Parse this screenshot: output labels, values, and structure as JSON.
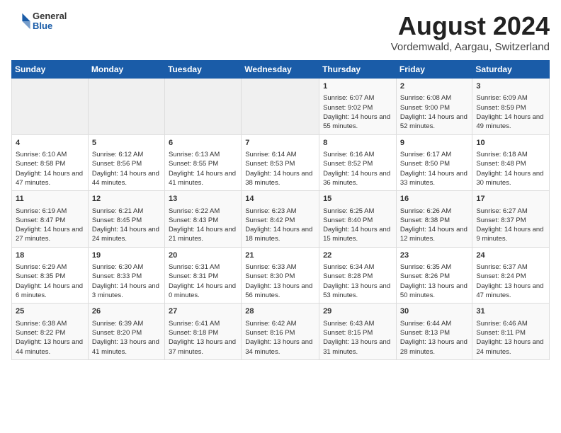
{
  "header": {
    "logo": {
      "general": "General",
      "blue": "Blue"
    },
    "title": "August 2024",
    "location": "Vordemwald, Aargau, Switzerland"
  },
  "weekdays": [
    "Sunday",
    "Monday",
    "Tuesday",
    "Wednesday",
    "Thursday",
    "Friday",
    "Saturday"
  ],
  "weeks": [
    [
      {
        "day": "",
        "empty": true
      },
      {
        "day": "",
        "empty": true
      },
      {
        "day": "",
        "empty": true
      },
      {
        "day": "",
        "empty": true
      },
      {
        "day": "1",
        "sunrise": "6:07 AM",
        "sunset": "9:02 PM",
        "daylight": "14 hours and 55 minutes."
      },
      {
        "day": "2",
        "sunrise": "6:08 AM",
        "sunset": "9:00 PM",
        "daylight": "14 hours and 52 minutes."
      },
      {
        "day": "3",
        "sunrise": "6:09 AM",
        "sunset": "8:59 PM",
        "daylight": "14 hours and 49 minutes."
      }
    ],
    [
      {
        "day": "4",
        "sunrise": "6:10 AM",
        "sunset": "8:58 PM",
        "daylight": "14 hours and 47 minutes."
      },
      {
        "day": "5",
        "sunrise": "6:12 AM",
        "sunset": "8:56 PM",
        "daylight": "14 hours and 44 minutes."
      },
      {
        "day": "6",
        "sunrise": "6:13 AM",
        "sunset": "8:55 PM",
        "daylight": "14 hours and 41 minutes."
      },
      {
        "day": "7",
        "sunrise": "6:14 AM",
        "sunset": "8:53 PM",
        "daylight": "14 hours and 38 minutes."
      },
      {
        "day": "8",
        "sunrise": "6:16 AM",
        "sunset": "8:52 PM",
        "daylight": "14 hours and 36 minutes."
      },
      {
        "day": "9",
        "sunrise": "6:17 AM",
        "sunset": "8:50 PM",
        "daylight": "14 hours and 33 minutes."
      },
      {
        "day": "10",
        "sunrise": "6:18 AM",
        "sunset": "8:48 PM",
        "daylight": "14 hours and 30 minutes."
      }
    ],
    [
      {
        "day": "11",
        "sunrise": "6:19 AM",
        "sunset": "8:47 PM",
        "daylight": "14 hours and 27 minutes."
      },
      {
        "day": "12",
        "sunrise": "6:21 AM",
        "sunset": "8:45 PM",
        "daylight": "14 hours and 24 minutes."
      },
      {
        "day": "13",
        "sunrise": "6:22 AM",
        "sunset": "8:43 PM",
        "daylight": "14 hours and 21 minutes."
      },
      {
        "day": "14",
        "sunrise": "6:23 AM",
        "sunset": "8:42 PM",
        "daylight": "14 hours and 18 minutes."
      },
      {
        "day": "15",
        "sunrise": "6:25 AM",
        "sunset": "8:40 PM",
        "daylight": "14 hours and 15 minutes."
      },
      {
        "day": "16",
        "sunrise": "6:26 AM",
        "sunset": "8:38 PM",
        "daylight": "14 hours and 12 minutes."
      },
      {
        "day": "17",
        "sunrise": "6:27 AM",
        "sunset": "8:37 PM",
        "daylight": "14 hours and 9 minutes."
      }
    ],
    [
      {
        "day": "18",
        "sunrise": "6:29 AM",
        "sunset": "8:35 PM",
        "daylight": "14 hours and 6 minutes."
      },
      {
        "day": "19",
        "sunrise": "6:30 AM",
        "sunset": "8:33 PM",
        "daylight": "14 hours and 3 minutes."
      },
      {
        "day": "20",
        "sunrise": "6:31 AM",
        "sunset": "8:31 PM",
        "daylight": "14 hours and 0 minutes."
      },
      {
        "day": "21",
        "sunrise": "6:33 AM",
        "sunset": "8:30 PM",
        "daylight": "13 hours and 56 minutes."
      },
      {
        "day": "22",
        "sunrise": "6:34 AM",
        "sunset": "8:28 PM",
        "daylight": "13 hours and 53 minutes."
      },
      {
        "day": "23",
        "sunrise": "6:35 AM",
        "sunset": "8:26 PM",
        "daylight": "13 hours and 50 minutes."
      },
      {
        "day": "24",
        "sunrise": "6:37 AM",
        "sunset": "8:24 PM",
        "daylight": "13 hours and 47 minutes."
      }
    ],
    [
      {
        "day": "25",
        "sunrise": "6:38 AM",
        "sunset": "8:22 PM",
        "daylight": "13 hours and 44 minutes."
      },
      {
        "day": "26",
        "sunrise": "6:39 AM",
        "sunset": "8:20 PM",
        "daylight": "13 hours and 41 minutes."
      },
      {
        "day": "27",
        "sunrise": "6:41 AM",
        "sunset": "8:18 PM",
        "daylight": "13 hours and 37 minutes."
      },
      {
        "day": "28",
        "sunrise": "6:42 AM",
        "sunset": "8:16 PM",
        "daylight": "13 hours and 34 minutes."
      },
      {
        "day": "29",
        "sunrise": "6:43 AM",
        "sunset": "8:15 PM",
        "daylight": "13 hours and 31 minutes."
      },
      {
        "day": "30",
        "sunrise": "6:44 AM",
        "sunset": "8:13 PM",
        "daylight": "13 hours and 28 minutes."
      },
      {
        "day": "31",
        "sunrise": "6:46 AM",
        "sunset": "8:11 PM",
        "daylight": "13 hours and 24 minutes."
      }
    ]
  ]
}
